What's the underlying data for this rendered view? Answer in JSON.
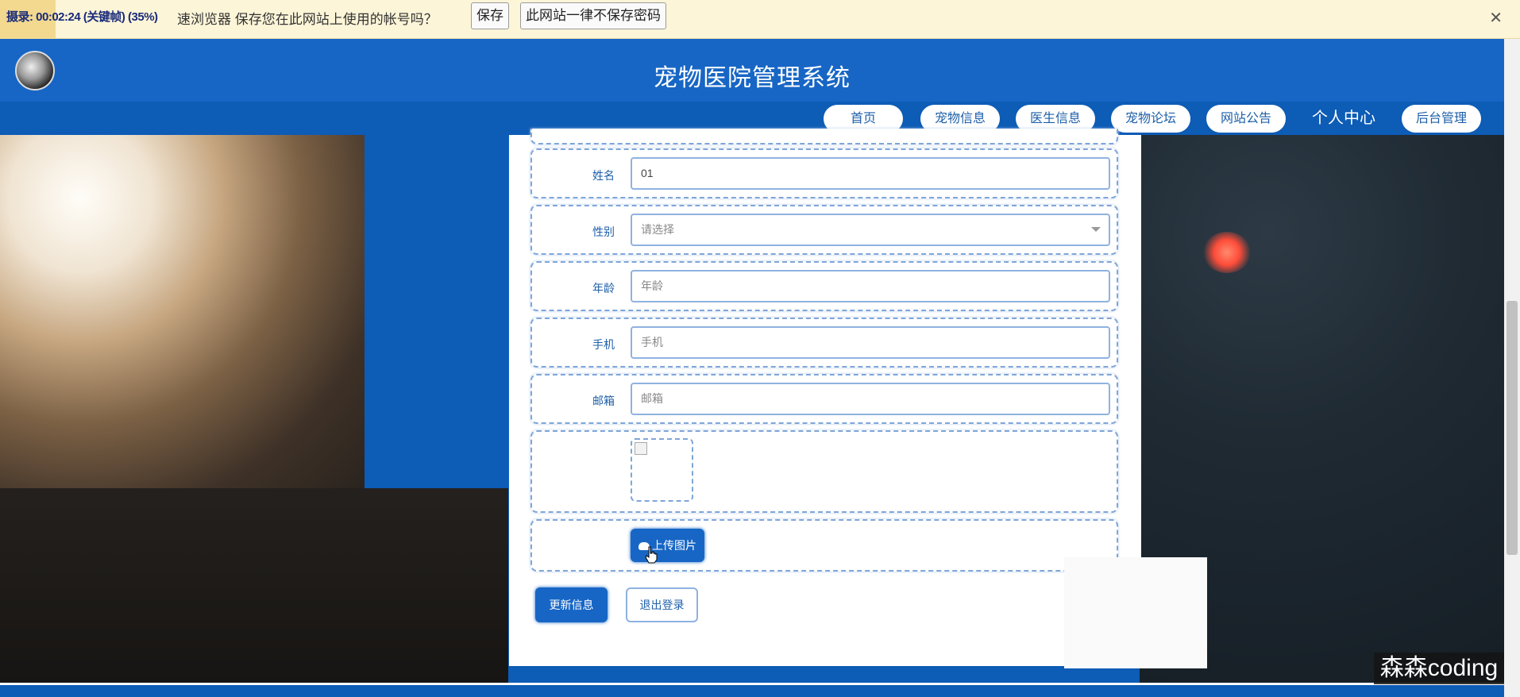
{
  "password_bar": {
    "recording_text": "摄录: 00:02:24 (关键帧) (35%)",
    "message": "速浏览器 保存您在此网站上使用的帐号吗？",
    "save_label": "保存",
    "never_label": "此网站一律不保存密码",
    "close_label": "✕"
  },
  "header": {
    "title": "宠物医院管理系统"
  },
  "nav": {
    "items": [
      "首页",
      "宠物信息",
      "医生信息",
      "宠物论坛",
      "网站公告"
    ],
    "personal": "个人中心",
    "admin": "后台管理"
  },
  "form": {
    "name": {
      "label": "姓名",
      "value": "01"
    },
    "gender": {
      "label": "性别",
      "value": "请选择"
    },
    "age": {
      "label": "年龄",
      "placeholder": "年龄"
    },
    "phone": {
      "label": "手机",
      "placeholder": "手机"
    },
    "email": {
      "label": "邮箱",
      "placeholder": "邮箱"
    },
    "upload_label": "上传图片",
    "update_label": "更新信息",
    "logout_label": "退出登录"
  },
  "watermark": "森森coding",
  "colors": {
    "primary": "#1766c5",
    "nav_bg": "#0d5cb6",
    "pw_bar_bg": "#fdf5d8"
  }
}
